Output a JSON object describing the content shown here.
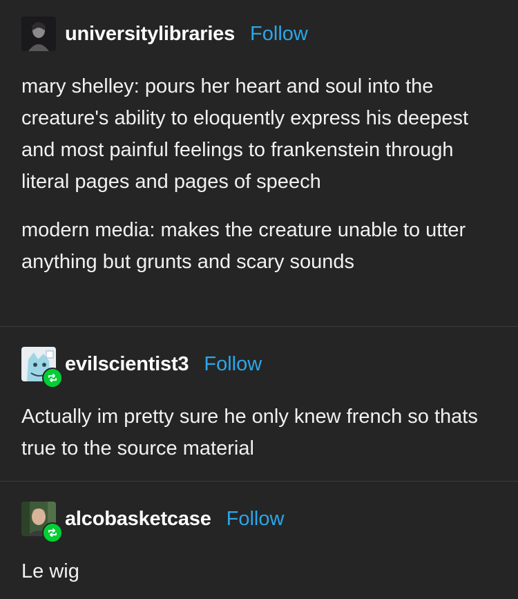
{
  "posts": [
    {
      "username": "universitylibraries",
      "follow_label": "Follow",
      "reblogged": false,
      "paragraphs": [
        "mary shelley: pours her heart and soul into the creature's ability to eloquently express his deepest and most painful feelings to frankenstein through literal pages and pages of speech",
        "modern media: makes the creature unable to utter anything but grunts and scary sounds"
      ]
    },
    {
      "username": "evilscientist3",
      "follow_label": "Follow",
      "reblogged": true,
      "paragraphs": [
        "Actually im pretty sure he only knew french so thats true to the source material"
      ]
    },
    {
      "username": "alcobasketcase",
      "follow_label": "Follow",
      "reblogged": true,
      "paragraphs": [
        "Le wig"
      ]
    }
  ],
  "colors": {
    "background": "#252526",
    "text": "#f1f1f1",
    "username": "#ffffff",
    "follow": "#2aa7e8",
    "divider": "#3c3c3d",
    "reblog_badge": "#00cf35"
  },
  "icons": {
    "reblog": "reblog-icon"
  }
}
